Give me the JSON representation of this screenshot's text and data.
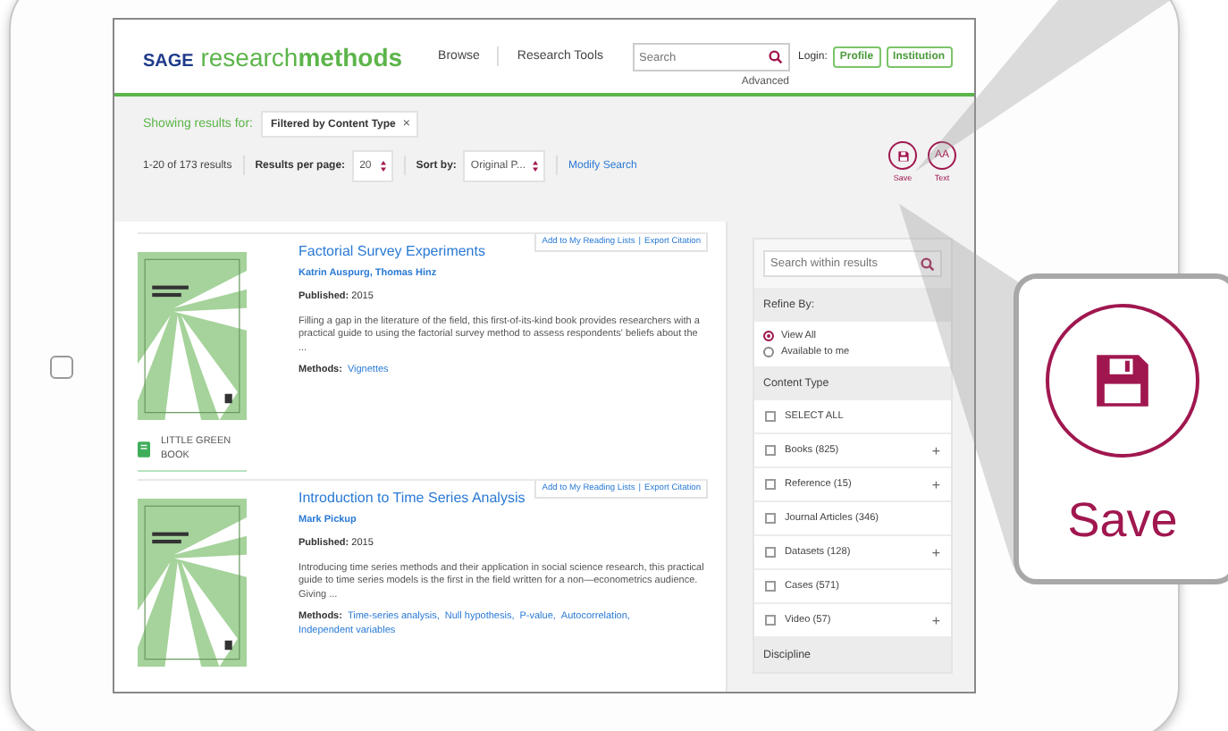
{
  "header": {
    "logo": {
      "brand": "SAGE",
      "light": "research",
      "bold": "methods"
    },
    "nav": [
      "Browse",
      "Research Tools"
    ],
    "search": {
      "placeholder": "Search"
    },
    "advanced": "Advanced",
    "login_label": "Login:",
    "login_buttons": [
      "Profile",
      "Institution"
    ]
  },
  "filters": {
    "showing_label": "Showing results for:",
    "chip": {
      "label": "Filtered by Content Type",
      "remove": "×"
    },
    "count": "1-20 of 173 results",
    "per_page": {
      "label": "Results per page:",
      "value": "20"
    },
    "sort": {
      "label": "Sort by:",
      "value": "Original P..."
    },
    "modify": "Modify Search",
    "tools": [
      {
        "kind": "save",
        "label": "Save"
      },
      {
        "kind": "text",
        "label": "Text",
        "glyph": "AA"
      }
    ]
  },
  "results": [
    {
      "actions": [
        "Add to My Reading Lists",
        "Export Citation"
      ],
      "separator": "|",
      "title": "Factorial Survey Experiments",
      "authors": "Katrin Auspurg, Thomas Hinz",
      "published_label": "Published:",
      "published": "2015",
      "abstract": "Filling a gap in the literature of the field, this first-of-its-kind book provides researchers with a practical guide to using the factorial survey method to assess respondents' beliefs about the ...",
      "methods_label": "Methods:",
      "methods": [
        "Vignettes"
      ],
      "badge": "LITTLE GREEN BOOK"
    },
    {
      "actions": [
        "Add to My Reading Lists",
        "Export Citation"
      ],
      "separator": "|",
      "title": "Introduction to Time Series Analysis",
      "authors": "Mark Pickup",
      "published_label": "Published:",
      "published": "2015",
      "abstract": "Introducing time series methods and their application in social science research, this practical guide to time series models is the first in the field written for a non—econometrics audience. Giving ...",
      "methods_label": "Methods:",
      "methods": [
        "Time-series analysis,",
        "Null hypothesis,",
        "P-value,",
        "Autocorrelation,",
        "Independent variables"
      ]
    }
  ],
  "sidebar": {
    "search": {
      "placeholder": "Search within results"
    },
    "refine_label": "Refine By:",
    "radios": [
      {
        "label": "View All",
        "selected": true
      },
      {
        "label": "Available to me",
        "selected": false
      }
    ],
    "content_type": "Content Type",
    "items": [
      {
        "label": "SELECT ALL",
        "checked": false,
        "expandable": false
      },
      {
        "label": "Books (825)",
        "checked": false,
        "expandable": true
      },
      {
        "label": "Reference (15)",
        "checked": false,
        "expandable": true
      },
      {
        "label": "Journal Articles (346)",
        "checked": false,
        "expandable": false
      },
      {
        "label": "Datasets (128)",
        "checked": false,
        "expandable": true
      },
      {
        "label": "Cases (571)",
        "checked": false,
        "expandable": false
      },
      {
        "label": "Video (57)",
        "checked": false,
        "expandable": true
      }
    ],
    "expand_glyph": "+",
    "discipline": "Discipline"
  },
  "callout": {
    "label": "Save"
  }
}
